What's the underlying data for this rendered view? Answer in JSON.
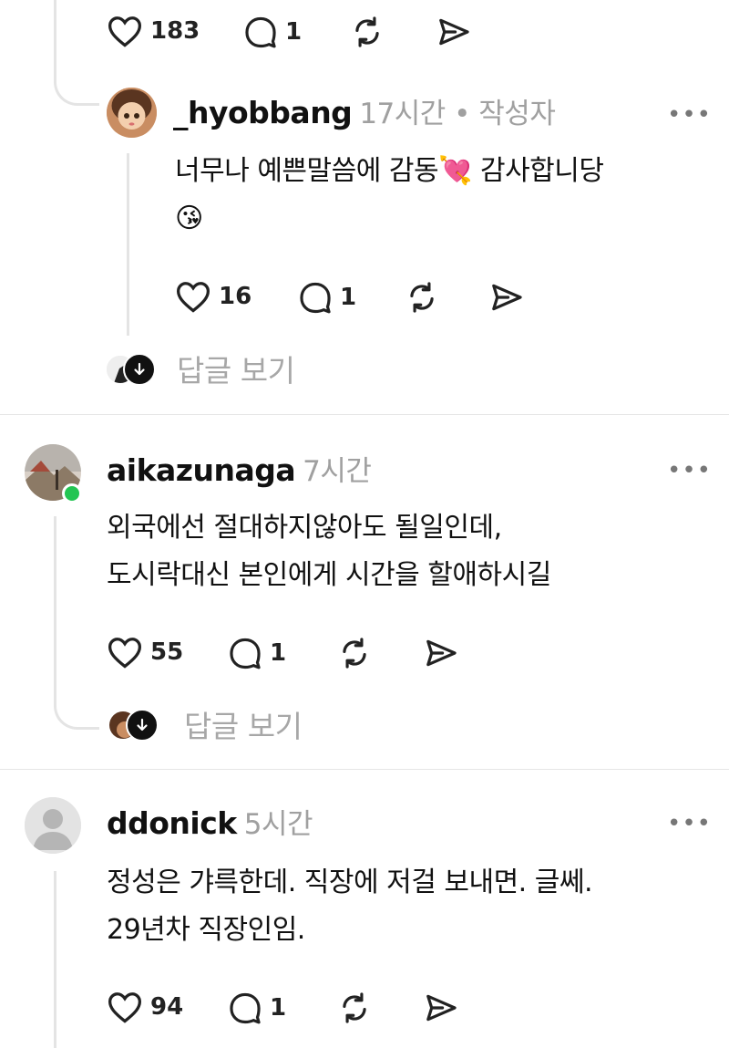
{
  "top_actions": {
    "likes": "183",
    "replies": "1"
  },
  "reply": {
    "username": "_hyobbang",
    "meta": "17시간 • 작성자",
    "line1": "너무나 예쁜말씀에 감동",
    "line1_emoji": "💘",
    "line1_end": " 감사합니당",
    "line2": "😘",
    "likes": "16",
    "replies": "1",
    "more": "•••"
  },
  "view_replies_1": "답글 보기",
  "comment2": {
    "username": "aikazunaga",
    "meta": "7시간",
    "line1": "외국에선 절대하지않아도 될일인데,",
    "line2": "도시락대신 본인에게 시간을 할애하시길",
    "likes": "55",
    "replies": "1",
    "more": "•••",
    "online_color": "#23c552"
  },
  "view_replies_2": "답글 보기",
  "comment3": {
    "username": "ddonick",
    "meta": "5시간",
    "line1": "정성은 갸륵한데.  직장에 저걸 보내면. 글쎄.",
    "line2": "29년차 직장인임.",
    "likes": "94",
    "replies": "1",
    "more": "•••"
  },
  "icons": [
    "heart-icon",
    "comment-icon",
    "repost-icon",
    "share-icon",
    "more-icon",
    "arrow-down-icon"
  ]
}
